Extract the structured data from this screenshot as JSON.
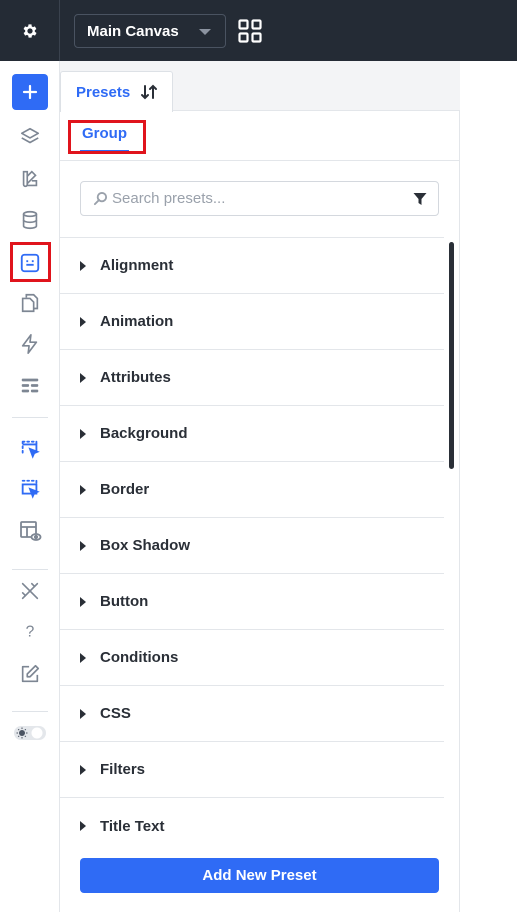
{
  "topbar": {
    "canvas_select": {
      "value": "Main Canvas"
    }
  },
  "sidebar": {
    "icons": [
      "add-icon",
      "layers-icon",
      "components-icon",
      "database-icon",
      "presets-icon",
      "pages-icon",
      "interactions-icon",
      "form-icon",
      "select-element-icon",
      "select-multiple-icon",
      "template-preview-icon",
      "tools-icon",
      "help-icon",
      "edit-icon",
      "theme-toggle-icon"
    ],
    "selected": "presets-icon"
  },
  "panel": {
    "tab_label": "Presets",
    "subtab_label": "Group",
    "search": {
      "placeholder": "Search presets..."
    },
    "presets": [
      "Alignment",
      "Animation",
      "Attributes",
      "Background",
      "Border",
      "Box Shadow",
      "Button",
      "Conditions",
      "CSS",
      "Filters",
      "Title Text"
    ],
    "add_button_label": "Add New Preset"
  },
  "colors": {
    "topbar_bg": "#242b35",
    "accent": "#2f6bf5",
    "highlight": "#e0141c",
    "text": "#2a2f37"
  }
}
